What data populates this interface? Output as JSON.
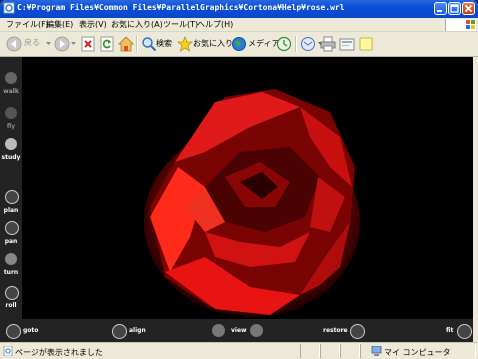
{
  "window": {
    "title": "C:¥Program Files¥Common Files¥ParallelGraphics¥Cortona¥Help¥rose.wrl"
  },
  "menu": {
    "items": [
      "ファイル(F)",
      "編集(E)",
      "表示(V)",
      "お気に入り(A)",
      "ツール(T)",
      "ヘルプ(H)"
    ]
  },
  "toolbar": {
    "back_label": "戻る",
    "search_label": "検索",
    "favorites_label": "お気に入り",
    "media_label": "メディア"
  },
  "viewer": {
    "left_controls": [
      "walk",
      "fly",
      "study",
      "plan",
      "pan",
      "turn",
      "roll"
    ],
    "bottom_controls": [
      "goto",
      "align",
      "view",
      "restore",
      "fit"
    ]
  },
  "statusbar": {
    "text": "ページが表示されました",
    "zone": "マイ コンピュータ"
  },
  "colors": {
    "titlebar": "#0a4fd8",
    "viewer_bg": "#000000",
    "rose": "#e01010",
    "panel": "#232323"
  }
}
